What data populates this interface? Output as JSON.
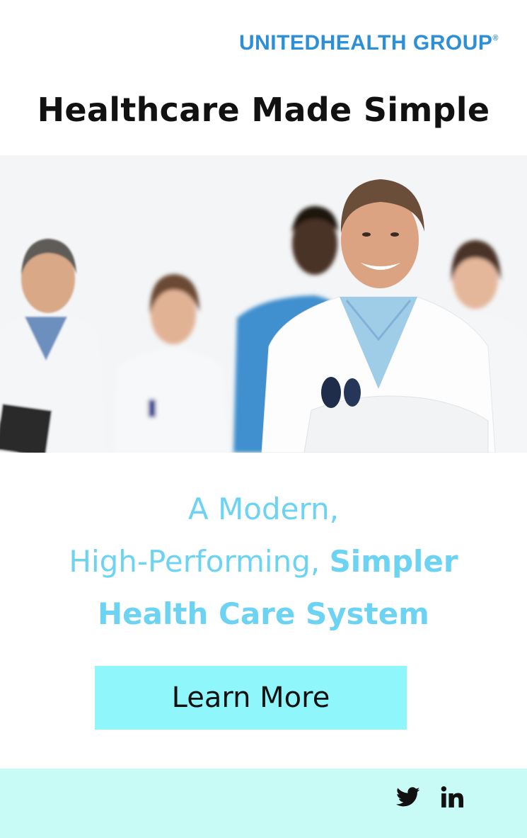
{
  "brand": {
    "logo": "UNITEDHEALTH GROUP",
    "registered_mark": "®",
    "color": "#2d8fd6"
  },
  "headline": "Healthcare Made Simple",
  "hero_image": {
    "subject": "doctors-group-photo"
  },
  "tagline": {
    "line1": "A Modern,",
    "line2_regular": "High-Performing, ",
    "line2_bold": "Simpler",
    "line3": "Health Care System",
    "color": "#6dd3f2"
  },
  "cta": {
    "label": "Learn More",
    "background": "#8ff6fb"
  },
  "footer": {
    "background": "#c9fbf6",
    "social": [
      {
        "icon": "twitter-icon"
      },
      {
        "icon": "linkedin-icon"
      }
    ]
  }
}
